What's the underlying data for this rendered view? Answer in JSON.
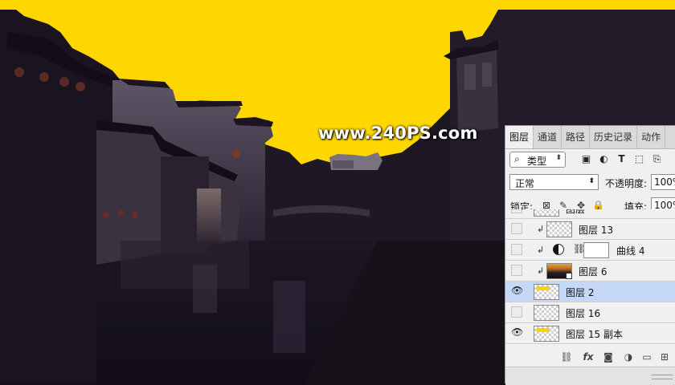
{
  "watermark": "www.240PS.com",
  "colors": {
    "sky": "#ffd700",
    "building_dark": "#241a2a",
    "canvas_base": "#140f1c",
    "panel_bg": "#f0f0f0",
    "selected_row": "#c5d8f7"
  },
  "panel": {
    "tabs": [
      {
        "label": "图层",
        "active": true
      },
      {
        "label": "通道",
        "active": false
      },
      {
        "label": "路径",
        "active": false
      },
      {
        "label": "历史记录",
        "active": false
      },
      {
        "label": "动作",
        "active": false
      }
    ],
    "filter": {
      "search_icon": "search-icon",
      "kind_label": "类型"
    },
    "filter_icons": [
      "image-filter-icon",
      "adjustment-filter-icon",
      "type-filter-icon",
      "shape-filter-icon",
      "smart-object-filter-icon"
    ],
    "blend_mode": "正常",
    "opacity_label": "不透明度:",
    "opacity_value": "100%",
    "lock_label": "锁定:",
    "lock_icons": [
      "lock-transparency-icon",
      "lock-paint-icon",
      "lock-position-icon",
      "lock-all-icon"
    ],
    "fill_label": "填充:",
    "fill_value": "100%",
    "layers": [
      {
        "name": "图层",
        "visible": false,
        "selected": false,
        "clipped": false,
        "thumb": "transparent"
      },
      {
        "name": "图层 13",
        "visible": false,
        "selected": false,
        "clipped": true,
        "thumb": "transparent"
      },
      {
        "name": "曲线 4",
        "visible": false,
        "selected": false,
        "clipped": true,
        "thumb": "white",
        "adjustment": "curves-adjustment-icon"
      },
      {
        "name": "图层 6",
        "visible": false,
        "selected": false,
        "clipped": true,
        "thumb": "photo",
        "smart_object": true
      },
      {
        "name": "图层 2",
        "visible": true,
        "selected": true,
        "clipped": false,
        "thumb": "yellow"
      },
      {
        "name": "图层 16",
        "visible": false,
        "selected": false,
        "clipped": false,
        "thumb": "transparent"
      },
      {
        "name": "图层 15 副本",
        "visible": true,
        "selected": false,
        "clipped": false,
        "thumb": "yellow"
      }
    ],
    "footer": {
      "fx": "fx",
      "icons": [
        "link-layers-icon",
        "fx-icon",
        "add-mask-icon",
        "adjustment-layer-icon",
        "new-group-icon",
        "new-layer-icon",
        "delete-layer-icon"
      ]
    }
  }
}
